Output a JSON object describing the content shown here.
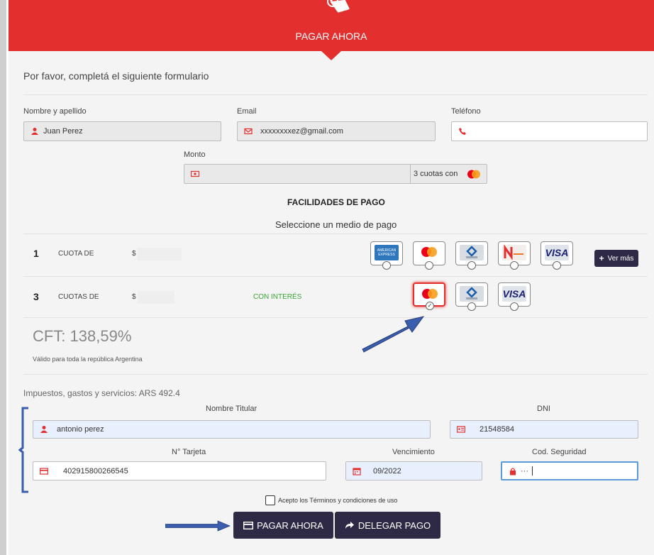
{
  "header": {
    "title": "PAGAR AHORA"
  },
  "form": {
    "intro": "Por favor, completá el siguiente formulario",
    "name_label": "Nombre y apellido",
    "name_value": "Juan Perez",
    "email_label": "Email",
    "email_value": "xxxxxxxxez@gmail.com",
    "phone_label": "Teléfono",
    "phone_value": "",
    "amount_label": "Monto",
    "amount_value": "",
    "installments_note": "3 cuotas con"
  },
  "payment": {
    "section_title": "FACILIDADES DE PAGO",
    "select_prompt": "Seleccione un medio de pago",
    "rows": [
      {
        "count": "1",
        "label": "CUOTA DE",
        "currency": "$",
        "interest": "",
        "cards": [
          "American Express",
          "Mastercard",
          "Cabal",
          "Naranja",
          "VISA"
        ]
      },
      {
        "count": "3",
        "label": "CUOTAS DE",
        "currency": "$",
        "interest": "CON INTERÉS",
        "cards": [
          "Mastercard",
          "Cabal",
          "VISA"
        ]
      }
    ],
    "more_button": "Ver más",
    "amex_text": "AMERICAN EXPRESS",
    "visa_text": "VISA",
    "cabal_text": "CABAL",
    "naranja_text": "Naranja",
    "cft": "CFT: 138,59%",
    "validity": "Válido para toda la república Argentina",
    "taxes": "Impuestos, gastos y servicios: ARS 492.4"
  },
  "card_form": {
    "holder_label": "Nombre Titular",
    "holder_value": "antonio perez",
    "dni_label": "DNI",
    "dni_value": "21548584",
    "card_label": "N° Tarjeta",
    "card_value": "402915800266545",
    "expiry_label": "Vencimiento",
    "expiry_value": "09/2022",
    "cvv_label": "Cod. Seguridad",
    "cvv_value": "···"
  },
  "terms": {
    "label": "Acepto los Términos y condiciones de uso",
    "checked": false
  },
  "actions": {
    "pay_label": "PAGAR AHORA",
    "delegate_label": "DELEGAR PAGO"
  },
  "colors": {
    "brand_red": "#e3302e",
    "button_dark": "#2e2a45",
    "interest_green": "#3aa335",
    "annotation_blue": "#3a5dae"
  }
}
